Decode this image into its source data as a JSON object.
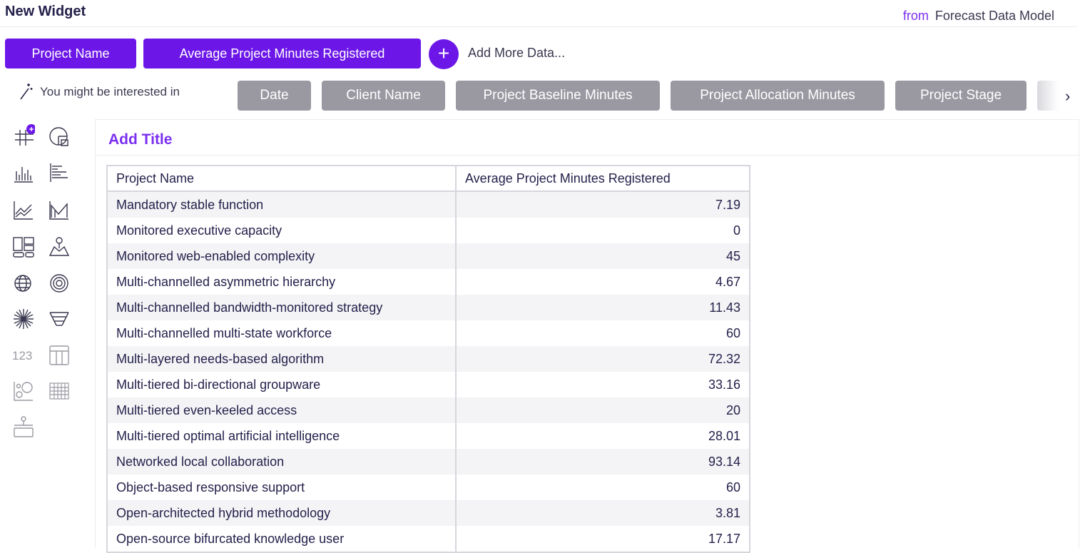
{
  "header": {
    "title": "New Widget",
    "source_prefix": "from",
    "source_name": "Forecast Data Model"
  },
  "fields": {
    "selected": [
      "Project Name",
      "Average Project Minutes Registered"
    ],
    "add_button_icon": "+",
    "add_more_label": "Add More Data..."
  },
  "suggestions": {
    "label": "You might be interested in",
    "icon": "magic-wand-icon",
    "items": [
      "Date",
      "Client Name",
      "Project Baseline Minutes",
      "Project Allocation Minutes",
      "Project Stage"
    ],
    "next_icon": "›"
  },
  "chart_types": {
    "number_label": "123",
    "icons": [
      "table-add-icon",
      "pie-chart-icon",
      "column-chart-icon",
      "bar-chart-icon",
      "line-chart-icon",
      "area-chart-icon",
      "treemap-icon",
      "map-pin-icon",
      "globe-icon",
      "radar-icon",
      "sunburst-icon",
      "funnel-icon",
      "number-icon",
      "pivot-table-icon",
      "scatter-icon",
      "heatmap-icon",
      "gauge-icon"
    ],
    "accent_color": "#6c17e8"
  },
  "widget": {
    "title": "Add Title",
    "columns": [
      "Project Name",
      "Average Project Minutes Registered"
    ],
    "rows": [
      [
        "Mandatory stable function",
        "7.19"
      ],
      [
        "Monitored executive capacity",
        "0"
      ],
      [
        "Monitored web-enabled complexity",
        "45"
      ],
      [
        "Multi-channelled asymmetric hierarchy",
        "4.67"
      ],
      [
        "Multi-channelled bandwidth-monitored strategy",
        "11.43"
      ],
      [
        "Multi-channelled multi-state workforce",
        "60"
      ],
      [
        "Multi-layered needs-based algorithm",
        "72.32"
      ],
      [
        "Multi-tiered bi-directional groupware",
        "33.16"
      ],
      [
        "Multi-tiered even-keeled access",
        "20"
      ],
      [
        "Multi-tiered optimal artificial intelligence",
        "28.01"
      ],
      [
        "Networked local collaboration",
        "93.14"
      ],
      [
        "Object-based responsive support",
        "60"
      ],
      [
        "Open-architected hybrid methodology",
        "3.81"
      ],
      [
        "Open-source bifurcated knowledge user",
        "17.17"
      ]
    ]
  }
}
